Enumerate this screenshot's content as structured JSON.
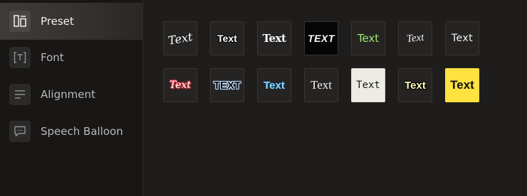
{
  "sidebar": {
    "items": [
      {
        "label": "Preset",
        "icon": "preset-icon",
        "active": true
      },
      {
        "label": "Font",
        "icon": "font-icon",
        "active": false
      },
      {
        "label": "Alignment",
        "icon": "alignment-icon",
        "active": false
      },
      {
        "label": "Speech Balloon",
        "icon": "speech-balloon-icon",
        "active": false
      }
    ]
  },
  "presets": {
    "rows": [
      [
        {
          "text": "Text",
          "style": "script-white"
        },
        {
          "text": "Text",
          "style": "outline-white"
        },
        {
          "text": "Text",
          "style": "blackletter-white"
        },
        {
          "text": "TEXT",
          "style": "bold-italic-on-black"
        },
        {
          "text": "Text",
          "style": "green-sans"
        },
        {
          "text": "Text",
          "style": "thin-script-white"
        },
        {
          "text": "Text",
          "style": "light-sans-white"
        }
      ],
      [
        {
          "text": "Text",
          "style": "red-script-glow"
        },
        {
          "text": "TEXT",
          "style": "heavy-blue-outline"
        },
        {
          "text": "Text",
          "style": "light-blue-bold"
        },
        {
          "text": "Text",
          "style": "serif-white"
        },
        {
          "text": "Text",
          "style": "mono-on-cream"
        },
        {
          "text": "Text",
          "style": "yellow-bold-outline"
        },
        {
          "text": "Text",
          "style": "black-on-yellow"
        }
      ]
    ]
  },
  "colors": {
    "sidebar_bg": "#191716",
    "main_bg": "#1f1d1c",
    "active_item": "#3e3b39",
    "tile_border": "#383532",
    "cream_tile": "#ecebe4",
    "yellow_tile": "#ffe23f"
  }
}
